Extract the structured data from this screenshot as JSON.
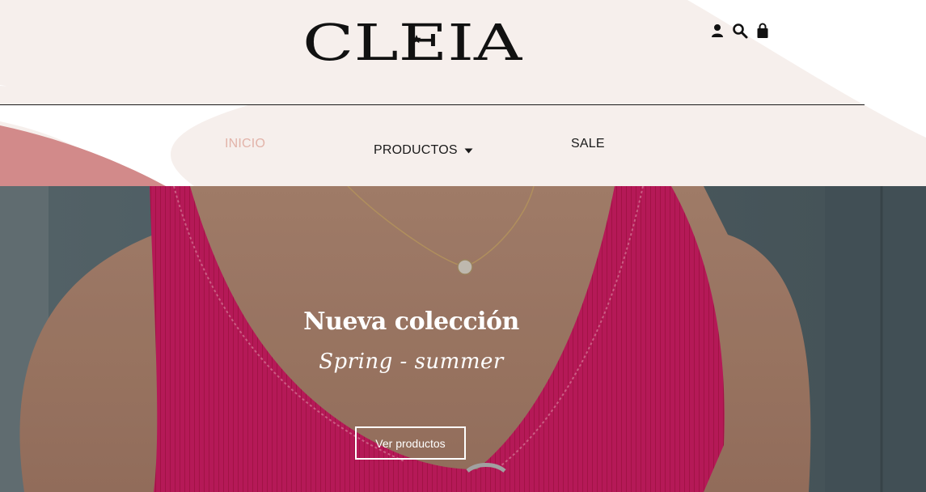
{
  "brand": {
    "name": "CLEIA"
  },
  "header": {
    "icons": [
      "user-icon",
      "search-icon",
      "shopping-bag-icon"
    ],
    "colors": {
      "blush": "#f6efec",
      "rose": "#d28a8a",
      "active_link": "#e2b3a9"
    }
  },
  "nav": {
    "inicio": "INICIO",
    "productos": "PRODUCTOS",
    "sale": "SALE"
  },
  "hero": {
    "title": "Nueva colección",
    "subtitle": "Spring - summer",
    "button_label": "Ver productos",
    "colors": {
      "top": "#cf1d63",
      "skin": "#c79a82",
      "wall": "#56666c"
    }
  }
}
